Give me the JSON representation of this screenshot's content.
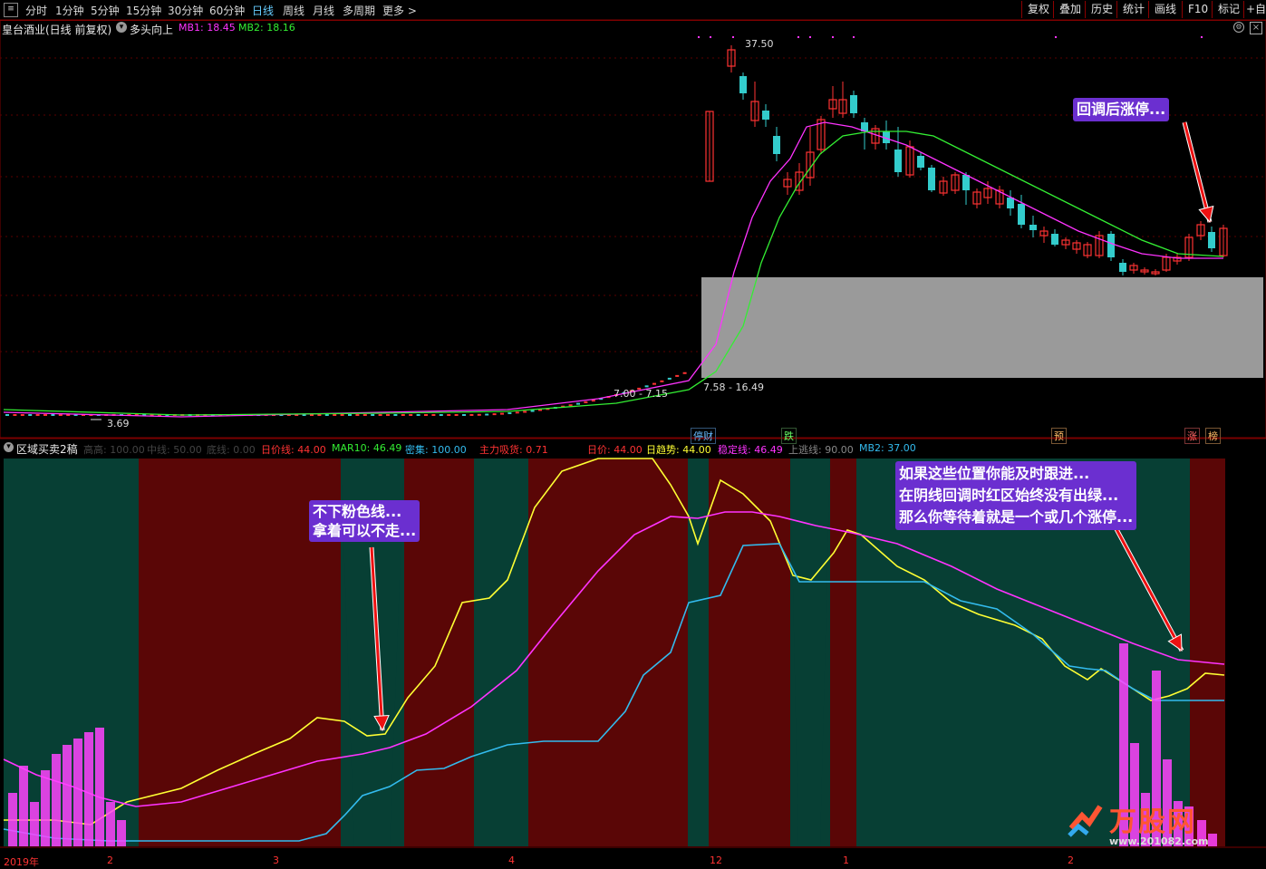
{
  "toolbar": {
    "periods": [
      "分时",
      "1分钟",
      "5分钟",
      "15分钟",
      "30分钟",
      "60分钟",
      "日线",
      "周线",
      "月线",
      "多周期",
      "更多 >"
    ],
    "active": "日线",
    "right_buttons": [
      "复权",
      "叠加",
      "历史",
      "统计",
      "画线",
      "F10",
      "标记",
      "+自选"
    ]
  },
  "main_chart": {
    "stock_title": "皇台酒业(日线 前复权)",
    "indicator_name": "多头向上",
    "mb1_label": "MB1: 18.45",
    "mb2_label": "MB2: 18.16",
    "high_label": "37.50",
    "low_label": "3.69",
    "range_label_1": "7.00 - 7.15",
    "range_label_2": "7.58 - 16.49",
    "event_tags": [
      "停财",
      "跌",
      "预",
      "涨",
      "榜"
    ],
    "colors": {
      "mb1": "#ff33ff",
      "mb2": "#33ee33",
      "up": "#ff3333",
      "down": "#33cccc",
      "zone": "#9a9a9a"
    }
  },
  "sub_chart": {
    "title": "区域买卖2稿",
    "labels": {
      "gray1": "高高: 100.00",
      "gray2": "中线: 50.00",
      "gray3": "底线: 0.00",
      "a": "日价线: 44.00",
      "b": "MAR10: 46.49",
      "c": "密集: 100.00",
      "d": "主力吸货: 0.71",
      "e": "日价: 44.00",
      "f": "日趋势: 44.00",
      "g": "稳定线: 46.49",
      "h": "上逃线: 90.00",
      "i": "MB2: 37.00"
    },
    "colors": {
      "green_zone": "#073f34",
      "red_zone": "#5a0606",
      "yellow": "#ffff33",
      "magenta": "#ff33ff",
      "cyan": "#33bbee",
      "bars": "#ff44ff"
    }
  },
  "axis": {
    "x_labels": [
      "2019年",
      "2",
      "3",
      "4",
      "12",
      "1",
      "2"
    ]
  },
  "annotations": {
    "top_right": "回调后涨停...",
    "middle_left": [
      "不下粉色线...",
      "拿着可以不走..."
    ],
    "right": [
      "如果这些位置你能及时跟进...",
      "在阴线回调时红区始终没有出绿...",
      "那么你等待着就是一个或几个涨停..."
    ]
  },
  "watermark": {
    "name": "万股网",
    "url": "www.201082.com"
  }
}
